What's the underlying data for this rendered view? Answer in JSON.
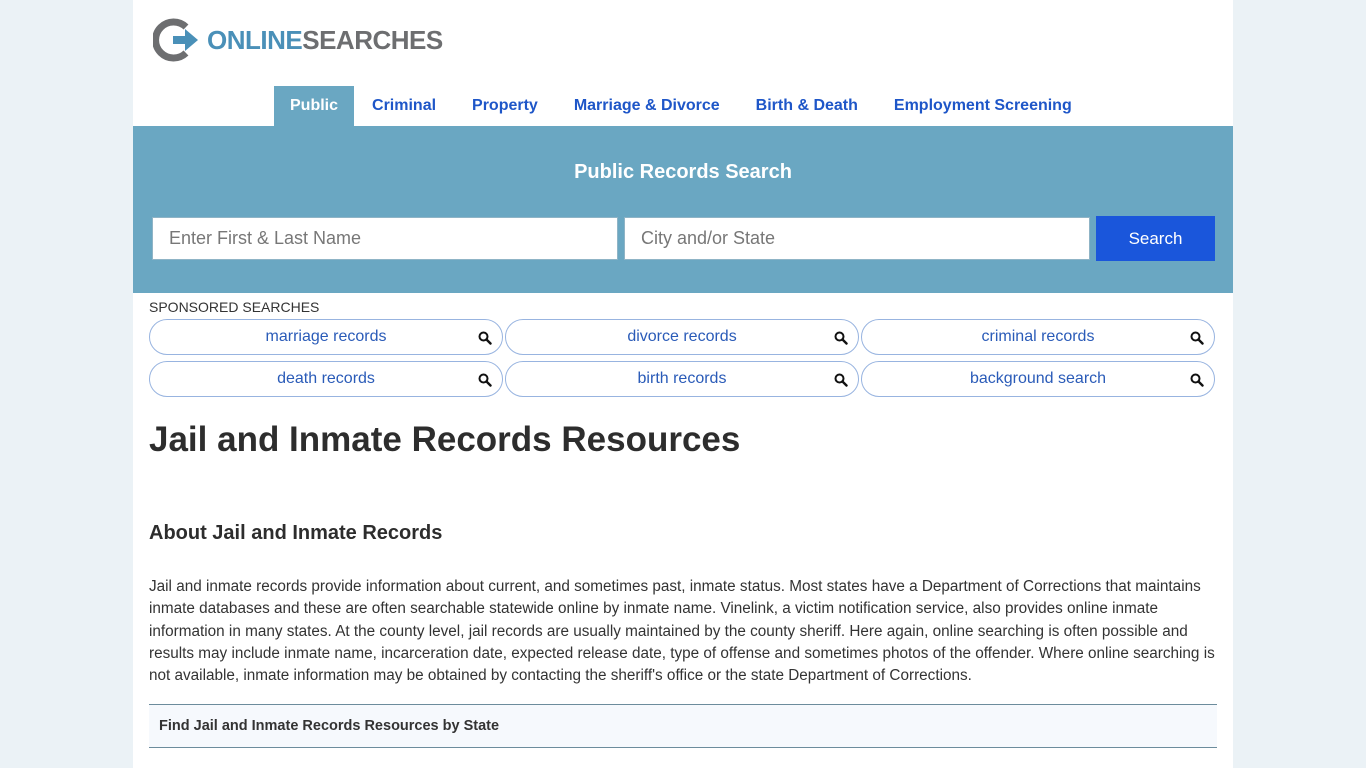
{
  "logo": {
    "part1": "ONLINE",
    "part2": "SEARCHES",
    "colors": {
      "ring": "#6d6e70",
      "arrow": "#4a90b8"
    }
  },
  "nav": {
    "items": [
      {
        "label": "Public",
        "active": true
      },
      {
        "label": "Criminal",
        "active": false
      },
      {
        "label": "Property",
        "active": false
      },
      {
        "label": "Marriage & Divorce",
        "active": false
      },
      {
        "label": "Birth & Death",
        "active": false
      },
      {
        "label": "Employment Screening",
        "active": false
      }
    ]
  },
  "search": {
    "title": "Public Records Search",
    "name_placeholder": "Enter First & Last Name",
    "name_value": "",
    "location_placeholder": "City and/or State",
    "location_value": "",
    "button_label": "Search"
  },
  "sponsored": {
    "label": "SPONSORED SEARCHES",
    "items": [
      {
        "label": "marriage records",
        "icon": "search-icon"
      },
      {
        "label": "divorce records",
        "icon": "search-icon"
      },
      {
        "label": "criminal records",
        "icon": "search-icon"
      },
      {
        "label": "death records",
        "icon": "search-icon"
      },
      {
        "label": "birth records",
        "icon": "search-icon"
      },
      {
        "label": "background search",
        "icon": "search-icon"
      }
    ]
  },
  "content": {
    "title": "Jail and Inmate Records Resources",
    "about_heading": "About Jail and Inmate Records",
    "about_text": "Jail and inmate records provide information about current, and sometimes past, inmate status. Most states have a Department of Corrections that maintains inmate databases and these are often searchable statewide online by inmate name. Vinelink, a victim notification service, also provides online inmate information in many states. At the county level, jail records are usually maintained by the county sheriff. Here again, online searching is often possible and results may include inmate name, incarceration date, expected release date, type of offense and sometimes photos of the offender. Where online searching is not available, inmate information may be obtained by contacting the sheriff's office or the state Department of Corrections.",
    "by_state_heading": "Find Jail and Inmate Records Resources by State"
  },
  "colors": {
    "page_bg": "#ebf2f6",
    "banner": "#6aa7c2",
    "nav_link": "#1e56c8",
    "search_button": "#1a56db",
    "pill_text": "#2a5bb8"
  }
}
